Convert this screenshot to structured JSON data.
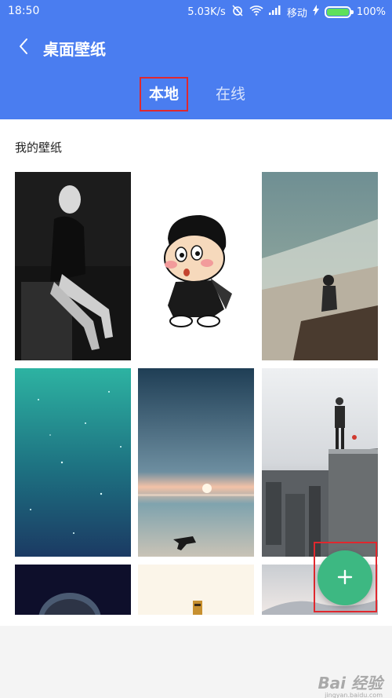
{
  "status_bar": {
    "time": "18:50",
    "network_speed": "5.03K/s",
    "carrier": "移动",
    "battery": "100%",
    "icons": [
      "alarm-off-icon",
      "wifi-icon",
      "signal-icon",
      "charging-icon",
      "battery-icon"
    ]
  },
  "app_bar": {
    "title": "桌面壁纸",
    "back_icon": "chevron-left-icon",
    "tabs": [
      {
        "label": "本地",
        "selected": true
      },
      {
        "label": "在线",
        "selected": false
      }
    ]
  },
  "content": {
    "section_label": "我的壁纸",
    "wallpapers": [
      {
        "name": "wallpaper-woman-bw"
      },
      {
        "name": "wallpaper-cartoon-boy"
      },
      {
        "name": "wallpaper-cliff-city"
      },
      {
        "name": "wallpaper-teal-space"
      },
      {
        "name": "wallpaper-beach-sunset-dog"
      },
      {
        "name": "wallpaper-skyscraper-man"
      },
      {
        "name": "wallpaper-dark-planet"
      },
      {
        "name": "wallpaper-cream-figure"
      },
      {
        "name": "wallpaper-hazy-mountain"
      }
    ]
  },
  "fab": {
    "icon": "plus-icon"
  },
  "watermark": {
    "text": "Bai 经验",
    "sub": "jingyan.baidu.com"
  },
  "colors": {
    "primary": "#4a7df0",
    "fab": "#3db882",
    "highlight_box": "#e0282e"
  }
}
